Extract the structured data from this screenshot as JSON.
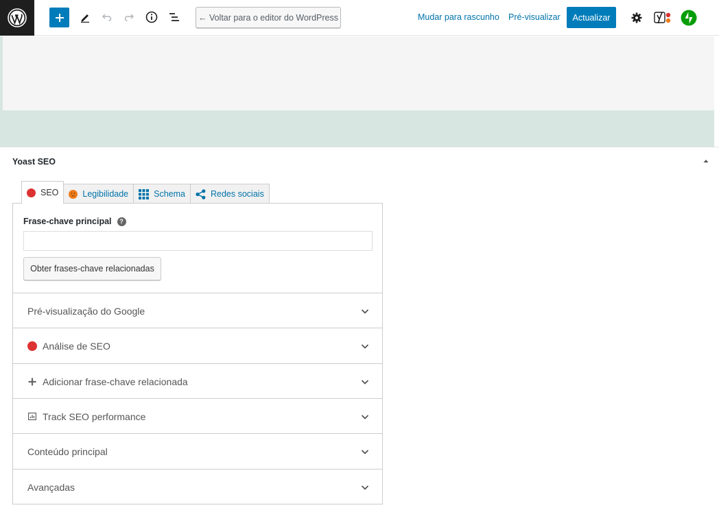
{
  "toolbar": {
    "back_label": "← Voltar para o editor do WordPress",
    "switch_draft_label": "Mudar para rascunho",
    "preview_label": "Pré-visualizar",
    "update_label": "Actualizar"
  },
  "metabox": {
    "title": "Yoast SEO"
  },
  "tabs": [
    {
      "label": "SEO",
      "icon": "red-dot-icon"
    },
    {
      "label": "Legibilidade",
      "icon": "orange-face-icon"
    },
    {
      "label": "Schema",
      "icon": "grid-icon"
    },
    {
      "label": "Redes sociais",
      "icon": "share-icon"
    }
  ],
  "focus_keyphrase": {
    "label": "Frase-chave principal",
    "value": "",
    "related_button": "Obter frases-chave relacionadas"
  },
  "sections": [
    {
      "label": "Pré-visualização do Google",
      "icon": ""
    },
    {
      "label": "Análise de SEO",
      "icon": "red-dot-icon"
    },
    {
      "label": "Adicionar frase-chave relacionada",
      "icon": "plus-icon"
    },
    {
      "label": "Track SEO performance",
      "icon": "chart-icon"
    },
    {
      "label": "Conteúdo principal",
      "icon": ""
    },
    {
      "label": "Avançadas",
      "icon": ""
    }
  ],
  "colors": {
    "accent": "#007cba",
    "link": "#0073aa",
    "bad": "#dc3232",
    "ok": "#ee7c1b",
    "jetpack": "#069e08"
  }
}
